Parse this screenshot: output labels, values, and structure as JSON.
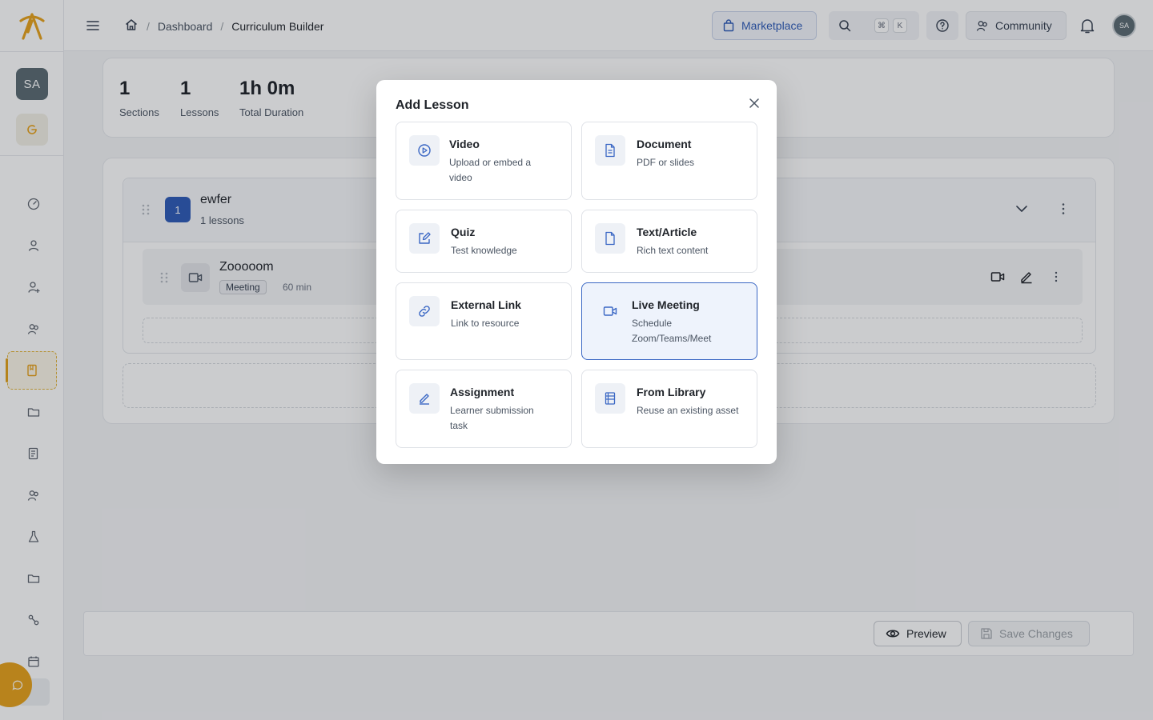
{
  "topbar": {
    "breadcrumb": [
      "Dashboard",
      "Curriculum Builder"
    ],
    "marketplace_label": "Marketplace",
    "search_shortcut": [
      "⌘",
      "K"
    ],
    "community_label": "Community",
    "avatar_initials": "SA"
  },
  "sidebar": {
    "avatar_initials": "SA",
    "items": [
      "dashboard",
      "learners",
      "add-user",
      "groups",
      "curriculum",
      "folders",
      "reports",
      "instructors",
      "labs",
      "files",
      "integrations",
      "calendar"
    ],
    "active_item": "curriculum"
  },
  "stats": [
    {
      "value": "1",
      "label": "Sections"
    },
    {
      "value": "1",
      "label": "Lessons"
    },
    {
      "value": "1h 0m",
      "label": "Total Duration"
    }
  ],
  "section": {
    "number": "1",
    "title": "ewfer",
    "subtitle": "1 lessons",
    "lesson": {
      "title": "Zooooom",
      "badge": "Meeting",
      "duration": "60 min"
    }
  },
  "footer": {
    "preview_label": "Preview",
    "save_label": "Save Changes"
  },
  "modal": {
    "title": "Add Lesson",
    "options": [
      {
        "name": "Video",
        "desc": "Upload or embed a video",
        "icon": "play-circle-icon"
      },
      {
        "name": "Document",
        "desc": "PDF or slides",
        "icon": "document-icon"
      },
      {
        "name": "Quiz",
        "desc": "Test knowledge",
        "icon": "edit-square-icon"
      },
      {
        "name": "Text/Article",
        "desc": "Rich text content",
        "icon": "file-icon"
      },
      {
        "name": "External Link",
        "desc": "Link to resource",
        "icon": "link-icon"
      },
      {
        "name": "Live Meeting",
        "desc": "Schedule Zoom/Teams/Meet",
        "icon": "video-camera-icon"
      },
      {
        "name": "Assignment",
        "desc": "Learner submission task",
        "icon": "pen-icon"
      },
      {
        "name": "From Library",
        "desc": "Reuse an existing asset",
        "icon": "library-icon"
      }
    ],
    "selected": "Live Meeting"
  },
  "colors": {
    "brand_orange": "#e7a21b",
    "accent_blue": "#2f5cb8",
    "selected_bg": "#eef3fc"
  }
}
